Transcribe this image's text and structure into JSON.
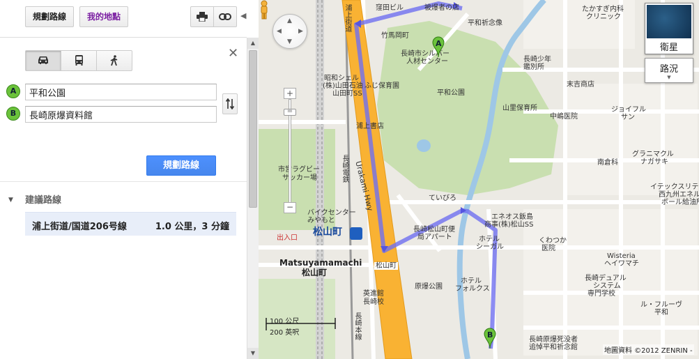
{
  "panel": {
    "tabs": {
      "directions": "規劃路線",
      "my_places": "我的地點"
    },
    "icons": {
      "print": "print-icon",
      "link": "link-icon",
      "collapse": "collapse-left-arrow-icon"
    },
    "modes": [
      {
        "name": "car",
        "active": true
      },
      {
        "name": "transit",
        "active": false
      },
      {
        "name": "walk",
        "active": false
      }
    ],
    "waypoints": {
      "a_marker": "A",
      "a_value": "平和公園",
      "b_marker": "B",
      "b_value": "長崎原爆資料館"
    },
    "get_directions_label": "規劃路線",
    "suggested_title": "建議路線",
    "route": {
      "name": "浦上街道/国道206号線",
      "distance": "1.0 公里，3 分鐘"
    }
  },
  "map": {
    "satellite_label": "衛星",
    "traffic_label": "路況",
    "scale": {
      "metric": "100 公尺",
      "imperial": "200 英呎"
    },
    "copyright": "地圖資料 ©2012 ZENRIN -",
    "markers": {
      "start": "A",
      "end": "B"
    },
    "labels": {
      "l1": "窪田ビル",
      "l2": "被爆者の店",
      "l3": "平和祈念像",
      "l4": "竹馬岡町",
      "l5": "長崎市シルバー",
      "l6": "人材センター",
      "l7": "昭和シェル",
      "l8": "(株)山田石油",
      "l9": "山田町SS",
      "l10": "ふじ保育園",
      "l11": "平和公園",
      "l12": "浦上街道",
      "l13": "長崎電鉄",
      "l14": "Urakami Hwy",
      "l15": "市営ラグビー",
      "l16": "サッカー場",
      "l17": "浦上書店",
      "l18": "ていびろ",
      "l19": "バイクセンター",
      "l20": "みやもと",
      "l21": "出入口",
      "l22": "松山町",
      "l23": "Matsuyamamachi",
      "l24": "松山町",
      "l25": "松山町",
      "l26": "長崎松山町便",
      "l27": "局アパート",
      "l28": "原爆公園",
      "l29": "英進館",
      "l30": "長崎校",
      "l31": "ホテル",
      "l32": "フォルクス",
      "l33": "ホテル",
      "l34": "シーガル",
      "l35": "エネオス飯島",
      "l36": "商事(株)松山SS",
      "l37": "くわつか",
      "l38": "医院",
      "l39": "Wisteria",
      "l40": "ヘイワマチ",
      "l41": "長崎デュアル",
      "l42": "システム",
      "l43": "専門学校",
      "l44": "ル・フルーヴ",
      "l45": "平和",
      "l46": "長崎原爆死没者",
      "l47": "追悼平和祈念館",
      "l48": "たかすぎ内科",
      "l49": "クリニック",
      "l50": "長崎少年",
      "l51": "鑑別所",
      "l52": "末吉商店",
      "l53": "山里保育所",
      "l54": "中嶋医院",
      "l55": "ジョイフル",
      "l56": "サン",
      "l57": "南倉科",
      "l58": "グラニマクル",
      "l59": "ナガサキ",
      "l60": "イテックスリテ",
      "l61": "西九州エネル",
      "l62": "ボール給油所",
      "l63": "長崎本線"
    }
  }
}
